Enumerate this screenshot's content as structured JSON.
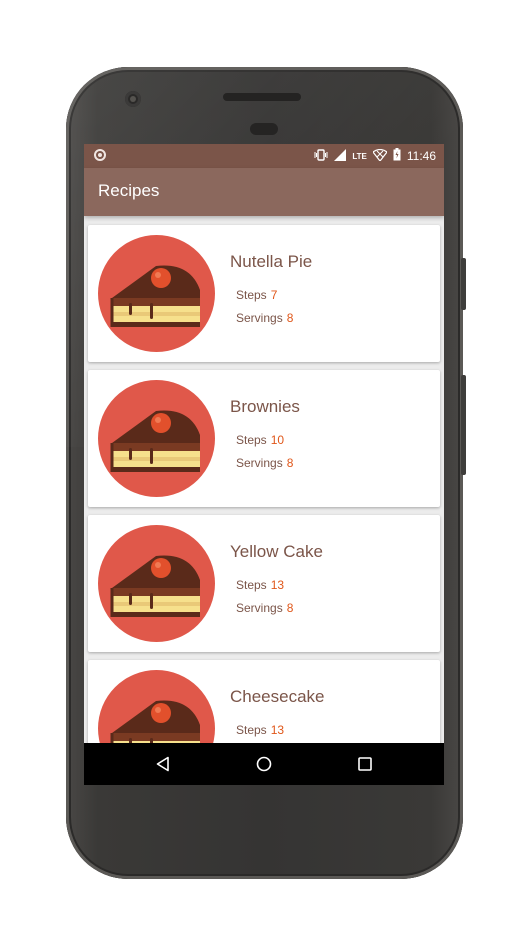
{
  "status_bar": {
    "time": "11:46",
    "network_label": "LTE",
    "icons": [
      "record-icon",
      "vibrate-icon",
      "signal-icon",
      "wifi-icon",
      "battery-icon"
    ]
  },
  "app_bar": {
    "title": "Recipes"
  },
  "labels": {
    "steps": "Steps",
    "servings": "Servings"
  },
  "recipes": [
    {
      "name": "Nutella Pie",
      "steps": "7",
      "servings": "8"
    },
    {
      "name": "Brownies",
      "steps": "10",
      "servings": "8"
    },
    {
      "name": "Yellow Cake",
      "steps": "13",
      "servings": "8"
    },
    {
      "name": "Cheesecake",
      "steps": "13",
      "servings": ""
    }
  ],
  "nav_bar": {
    "icons": [
      "back-icon",
      "home-icon",
      "recents-icon"
    ]
  },
  "colors": {
    "status_bar": "#7b5549",
    "app_bar": "#8b685d",
    "accent_number": "#e0571a",
    "text_brown": "#7b5549",
    "icon_circle": "#e0584a",
    "cake_chocolate": "#5a2a1a",
    "cake_cherry": "#e2502c",
    "cake_cream": "#f6e08c"
  }
}
